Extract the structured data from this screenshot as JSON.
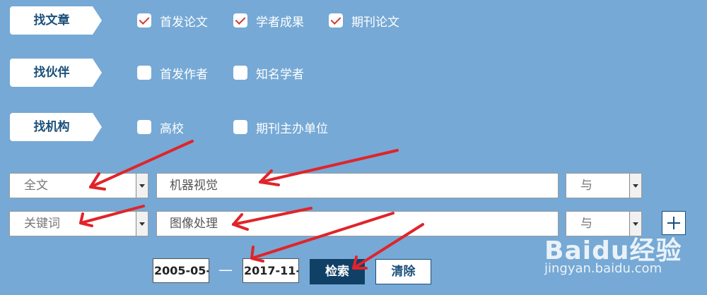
{
  "categories": [
    {
      "tag": "找文章",
      "options": [
        {
          "label": "首发论文",
          "checked": true
        },
        {
          "label": "学者成果",
          "checked": true
        },
        {
          "label": "期刊论文",
          "checked": true
        }
      ]
    },
    {
      "tag": "找伙伴",
      "options": [
        {
          "label": "首发作者",
          "checked": false
        },
        {
          "label": "知名学者",
          "checked": false
        }
      ]
    },
    {
      "tag": "找机构",
      "options": [
        {
          "label": "高校",
          "checked": false
        },
        {
          "label": "期刊主办单位",
          "checked": false
        }
      ]
    }
  ],
  "search_rows": [
    {
      "field": "全文",
      "query": "机器视觉",
      "logic": "与"
    },
    {
      "field": "关键词",
      "query": "图像处理",
      "logic": "与"
    }
  ],
  "date_range": {
    "start": "2005-05-",
    "separator": "—",
    "end": "2017-11-"
  },
  "buttons": {
    "search": "检索",
    "clear": "清除"
  },
  "watermark": {
    "logo": "Baidu经验",
    "url": "jingyan.baidu.com"
  },
  "colors": {
    "background": "#76a9d5",
    "accent": "#104066",
    "check": "#d9362b",
    "annotation": "#e0242a"
  }
}
